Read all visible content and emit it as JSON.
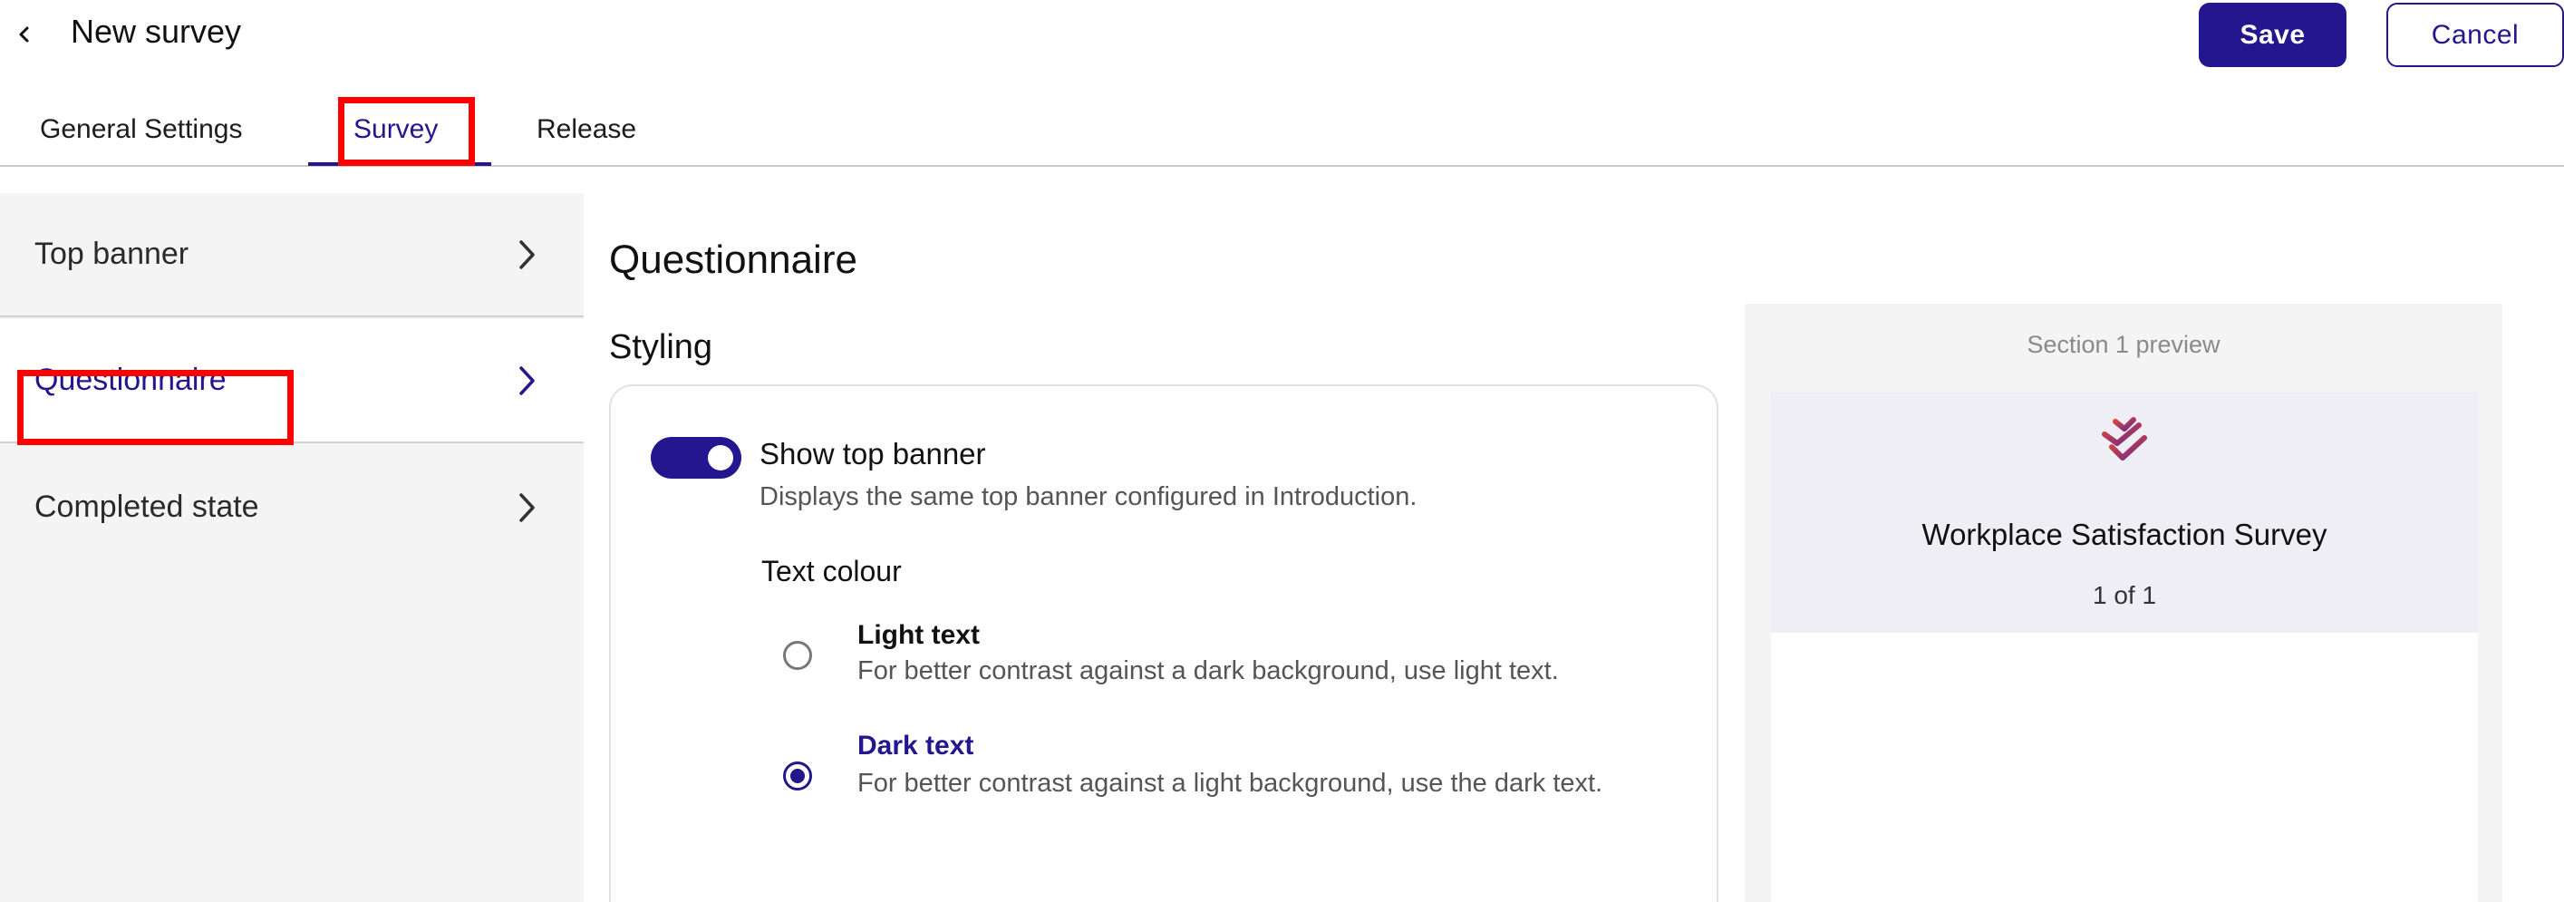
{
  "header": {
    "back_icon": "chevron-left-icon",
    "title": "New survey",
    "save_label": "Save",
    "cancel_label": "Cancel"
  },
  "tabs": [
    {
      "label": "General Settings",
      "active": false
    },
    {
      "label": "Survey",
      "active": true
    },
    {
      "label": "Release",
      "active": false
    }
  ],
  "sidebar": {
    "items": [
      {
        "label": "Top banner",
        "active": false,
        "icon": "chevron-right-icon"
      },
      {
        "label": "Questionnaire",
        "active": true,
        "icon": "chevron-right-icon"
      },
      {
        "label": "Completed state",
        "active": false,
        "icon": "chevron-right-icon"
      }
    ]
  },
  "main": {
    "title": "Questionnaire",
    "section_title": "Styling",
    "toggle": {
      "label": "Show top banner",
      "description": "Displays the same top banner configured in Introduction.",
      "on": true
    },
    "text_colour": {
      "heading": "Text colour",
      "options": [
        {
          "title": "Light text",
          "description": "For better contrast against a dark background, use light text.",
          "selected": false
        },
        {
          "title": "Dark text",
          "description": "For better contrast against a light background, use the dark text.",
          "selected": true
        }
      ]
    }
  },
  "preview": {
    "label": "Section 1 preview",
    "logo_icon": "brand-logo-icon",
    "survey_title": "Workplace Satisfaction Survey",
    "page_indicator": "1 of 1"
  },
  "colors": {
    "accent": "#24168f",
    "highlight": "#ff0000",
    "sidebar_bg": "#f4f4f4",
    "preview_bg": "#f4f4f4"
  }
}
